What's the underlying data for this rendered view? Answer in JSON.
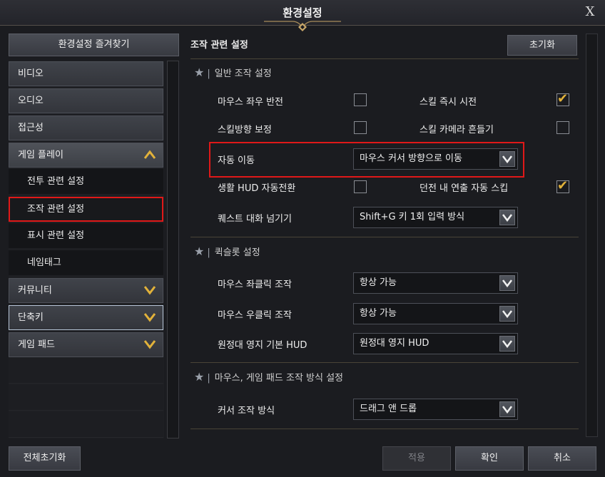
{
  "window": {
    "title": "환경설정",
    "close_glyph": "X"
  },
  "left": {
    "favorites_label": "환경설정 즐겨찾기",
    "nav": [
      {
        "label": "비디오"
      },
      {
        "label": "오디오"
      },
      {
        "label": "접근성"
      },
      {
        "label": "게임 플레이",
        "expanded": true
      },
      {
        "label": "전투 관련 설정",
        "sub": true
      },
      {
        "label": "조작 관련 설정",
        "sub": true,
        "selected": true
      },
      {
        "label": "표시 관련 설정",
        "sub": true
      },
      {
        "label": "네임태그",
        "sub": true
      },
      {
        "label": "커뮤니티"
      },
      {
        "label": "단축키"
      },
      {
        "label": "게임 패드"
      }
    ]
  },
  "main": {
    "section_title": "조작 관련 설정",
    "reset_label": "초기화",
    "groups": [
      {
        "title": "일반 조작 설정",
        "items": [
          {
            "label": "마우스 좌우 반전",
            "checked": false
          },
          {
            "label": "스킬 즉시 시전",
            "checked": true
          },
          {
            "label": "스킬방향 보정",
            "checked": false
          },
          {
            "label": "스킬 카메라 흔들기",
            "checked": false
          },
          {
            "label": "자동 이동",
            "value": "마우스 커서 방향으로 이동"
          },
          {
            "label": "생활 HUD 자동전환",
            "checked": false
          },
          {
            "label": "던전 내 연출 자동 스킵",
            "checked": true
          },
          {
            "label": "퀘스트 대화 넘기기",
            "value": "Shift+G 키 1회 입력 방식"
          }
        ]
      },
      {
        "title": "퀵슬롯 설정",
        "items": [
          {
            "label": "마우스 좌클릭 조작",
            "value": "항상 가능"
          },
          {
            "label": "마우스 우클릭 조작",
            "value": "항상 가능"
          },
          {
            "label": "원정대 영지 기본 HUD",
            "value": "원정대 영지 HUD"
          }
        ]
      },
      {
        "title": "마우스, 게임 패드 조작 방식 설정",
        "items": [
          {
            "label": "커서 조작 방식",
            "value": "드래그 앤 드롭"
          }
        ]
      }
    ]
  },
  "footer": {
    "reset_all": "전체초기화",
    "apply": "적용",
    "ok": "확인",
    "cancel": "취소"
  },
  "colors": {
    "accent_check": "#e2b23a",
    "highlight": "#e01818"
  }
}
